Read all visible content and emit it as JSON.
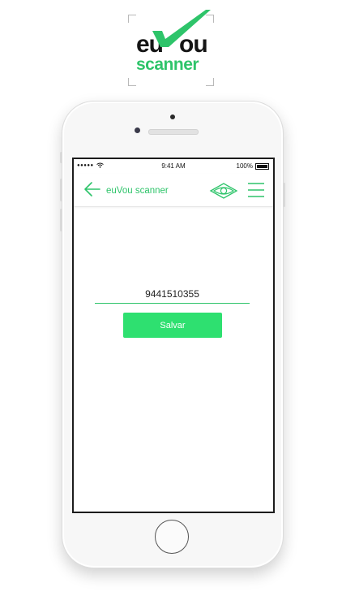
{
  "logo": {
    "top_text_1": "eu",
    "top_text_2": "ou",
    "bottom_text": "scanner"
  },
  "status_bar": {
    "time": "9:41 AM",
    "battery": "100%"
  },
  "app_bar": {
    "title": "euVou scanner"
  },
  "form": {
    "code_value": "9441510355",
    "save_label": "Salvar"
  },
  "colors": {
    "accent": "#2ec46a",
    "button": "#2ee070"
  },
  "icons": [
    "back-arrow-icon",
    "eye-icon",
    "menu-icon",
    "wifi-icon",
    "battery-icon",
    "checkmark-icon"
  ]
}
